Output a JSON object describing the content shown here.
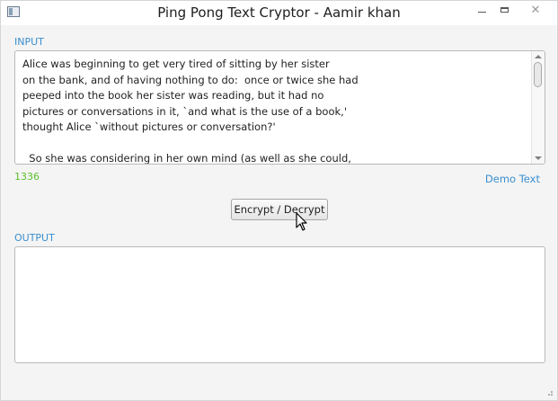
{
  "window": {
    "title": "Ping Pong Text Cryptor - Aamir khan",
    "controls": {
      "minimize": "minimize",
      "maximize": "maximize",
      "close": "✕"
    }
  },
  "input": {
    "label": "INPUT",
    "text": "Alice was beginning to get very tired of sitting by her sister\non the bank, and of having nothing to do:  once or twice she had\npeeped into the book her sister was reading, but it had no\npictures or conversations in it, `and what is the use of a book,'\nthought Alice `without pictures or conversation?'\n\n  So she was considering in her own mind (as well as she could,"
  },
  "char_count": "1336",
  "demo_link": "Demo Text",
  "action_button": "Encrypt / Decrypt",
  "output": {
    "label": "OUTPUT",
    "text": ""
  },
  "colors": {
    "label_blue": "#3a8fd0",
    "count_green": "#5cbf2a"
  },
  "icons": [
    "app-icon",
    "minimize-icon",
    "maximize-icon",
    "close-icon",
    "mouse-cursor-icon",
    "resize-grip-icon"
  ]
}
